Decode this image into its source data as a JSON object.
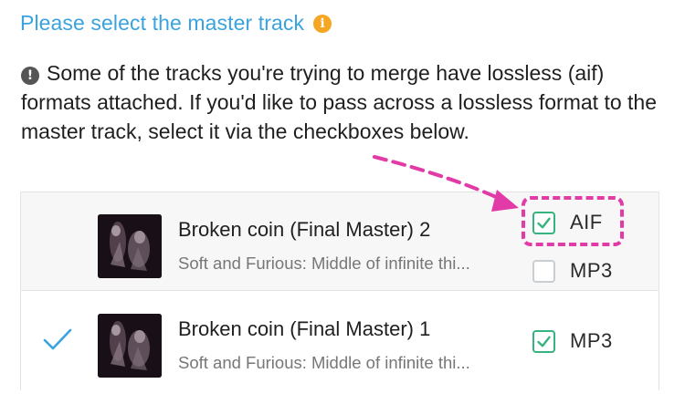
{
  "header": {
    "title": "Please select the master track",
    "info_glyph": "i"
  },
  "notice": {
    "glyph": "!",
    "text": "Some of the tracks you're trying to merge have lossless (aif) formats attached. If you'd like to pass across a lossless format to the master track, select it via the checkboxes below."
  },
  "tracks": [
    {
      "title": "Broken coin (Final Master) 2",
      "subtitle": "Soft and Furious: Middle of infinite thi...",
      "selected": false,
      "formats": [
        {
          "label": "AIF",
          "checked": true
        },
        {
          "label": "MP3",
          "checked": false
        }
      ]
    },
    {
      "title": "Broken coin (Final Master) 1",
      "subtitle": "Soft and Furious: Middle of infinite thi...",
      "selected": true,
      "formats": [
        {
          "label": "MP3",
          "checked": true
        }
      ]
    }
  ],
  "colors": {
    "accent": "#3aa3de",
    "info": "#f5a623",
    "check_green": "#36b37e",
    "annotation": "#e23aa6"
  }
}
